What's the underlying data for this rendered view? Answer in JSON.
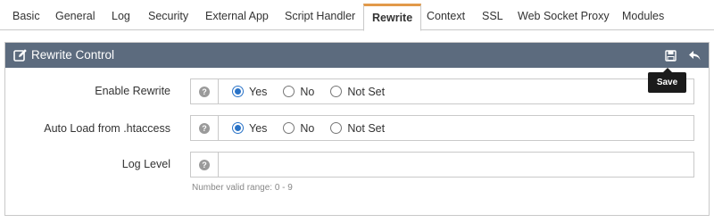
{
  "tabs": [
    {
      "label": "Basic"
    },
    {
      "label": "General"
    },
    {
      "label": "Log"
    },
    {
      "label": "Security"
    },
    {
      "label": "External App"
    },
    {
      "label": "Script Handler"
    },
    {
      "label": "Rewrite",
      "active": true
    },
    {
      "label": "Context"
    },
    {
      "label": "SSL"
    },
    {
      "label": "Web Socket Proxy"
    },
    {
      "label": "Modules"
    }
  ],
  "panel": {
    "title": "Rewrite Control",
    "tooltip": "Save"
  },
  "fields": {
    "enable_rewrite": {
      "label": "Enable Rewrite",
      "options": [
        "Yes",
        "No",
        "Not Set"
      ],
      "selected": "Yes"
    },
    "auto_load": {
      "label": "Auto Load from .htaccess",
      "options": [
        "Yes",
        "No",
        "Not Set"
      ],
      "selected": "Yes"
    },
    "log_level": {
      "label": "Log Level",
      "value": "",
      "hint": "Number valid range: 0 - 9"
    }
  },
  "help_glyph": "?",
  "colors": {
    "header_bg": "#5c6b7e",
    "active_tab_accent": "#e29a4a",
    "radio_accent": "#2a73c7"
  }
}
